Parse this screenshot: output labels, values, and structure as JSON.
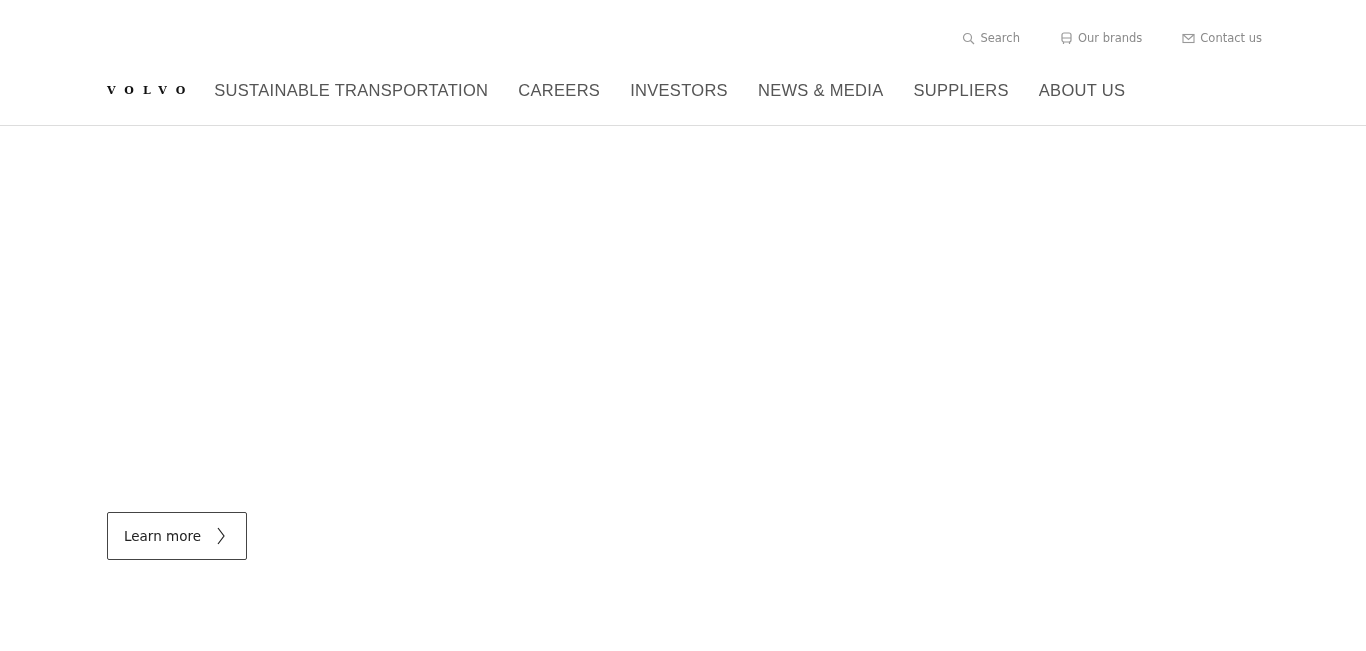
{
  "utility_links": [
    {
      "kind": "search",
      "label": "Search"
    },
    {
      "kind": "brands",
      "label": "Our brands"
    },
    {
      "kind": "contact",
      "label": "Contact us"
    }
  ],
  "logo": "VOLVO",
  "nav": [
    "SUSTAINABLE TRANSPORTATION",
    "CAREERS",
    "INVESTORS",
    "NEWS & MEDIA",
    "SUPPLIERS",
    "ABOUT US"
  ],
  "hero": {
    "button": "Learn more"
  }
}
